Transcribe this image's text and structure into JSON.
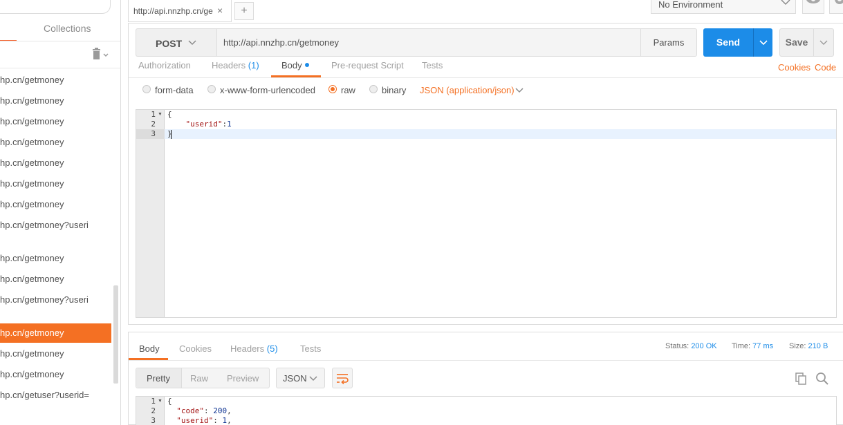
{
  "sidebar": {
    "tabs": {
      "collections": "Collections"
    },
    "items": [
      {
        "label": "hp.cn/getmoney"
      },
      {
        "label": "hp.cn/getmoney"
      },
      {
        "label": "hp.cn/getmoney"
      },
      {
        "label": "hp.cn/getmoney"
      },
      {
        "label": "hp.cn/getmoney"
      },
      {
        "label": "hp.cn/getmoney"
      },
      {
        "label": "hp.cn/getmoney"
      },
      {
        "label": "hp.cn/getmoney?useri"
      },
      {
        "label": "hp.cn/getmoney"
      },
      {
        "label": "hp.cn/getmoney"
      },
      {
        "label": "hp.cn/getmoney?useri"
      },
      {
        "label": "hp.cn/getmoney",
        "active": true
      },
      {
        "label": "hp.cn/getmoney"
      },
      {
        "label": "hp.cn/getmoney"
      },
      {
        "label": "hp.cn/getuser?userid="
      }
    ]
  },
  "tabbar": {
    "request_tab": "http://api.nnzhp.cn/ge",
    "close": "×",
    "new_tab": "+",
    "environment": "No Environment"
  },
  "request": {
    "method": "POST",
    "url": "http://api.nnzhp.cn/getmoney",
    "params_label": "Params",
    "send_label": "Send",
    "save_label": "Save",
    "tabs": {
      "authorization": "Authorization",
      "headers": "Headers",
      "headers_count": "(1)",
      "body": "Body",
      "prerequest": "Pre-request Script",
      "tests": "Tests"
    },
    "links": {
      "cookies": "Cookies",
      "code": "Code"
    },
    "body_types": {
      "form_data": "form-data",
      "urlencoded": "x-www-form-urlencoded",
      "raw": "raw",
      "binary": "binary",
      "content_type": "JSON (application/json)"
    },
    "editor": {
      "line_numbers": [
        "1",
        "2",
        "3"
      ],
      "lines": {
        "open": "{",
        "key": "\"userid\"",
        "colon": ":",
        "value": "1",
        "close": "}"
      }
    }
  },
  "response": {
    "tabs": {
      "body": "Body",
      "cookies": "Cookies",
      "headers": "Headers",
      "headers_count": "(5)",
      "tests": "Tests"
    },
    "status_label": "Status:",
    "status_value": "200 OK",
    "time_label": "Time:",
    "time_value": "77 ms",
    "size_label": "Size:",
    "size_value": "210 B",
    "view_modes": {
      "pretty": "Pretty",
      "raw": "Raw",
      "preview": "Preview"
    },
    "format": "JSON",
    "editor": {
      "line_numbers": [
        "1",
        "2",
        "3"
      ],
      "open": "{",
      "code_key": "\"code\"",
      "code_value": "200",
      "userid_key": "\"userid\"",
      "userid_value": "1"
    }
  },
  "colors": {
    "accent_orange": "#f47023",
    "send_blue": "#1c8ce8"
  }
}
